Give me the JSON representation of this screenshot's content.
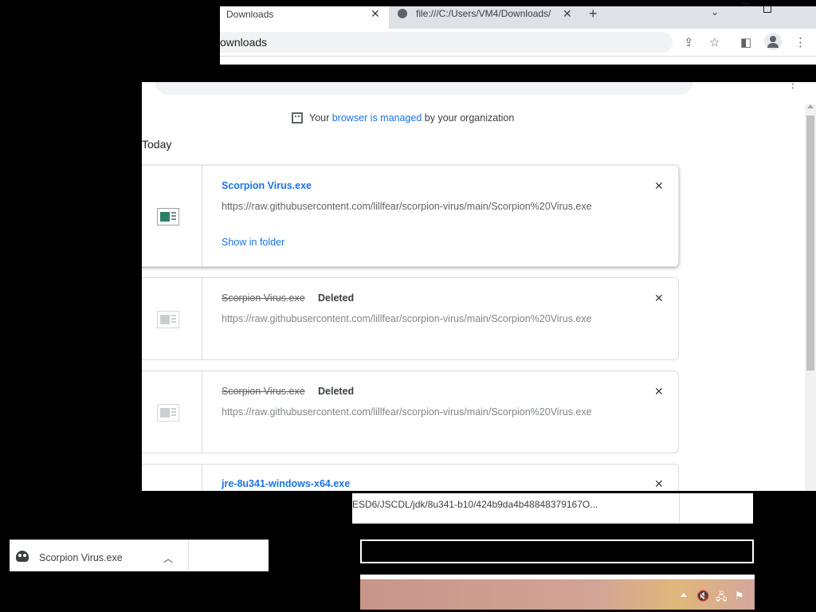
{
  "browser": {
    "tabs": [
      {
        "title": "Downloads",
        "active": true
      },
      {
        "title": "file:///C:/Users/VM4/Downloads/",
        "active": false
      }
    ],
    "omnibox_text": "ownloads",
    "icons": {
      "share": "share-icon",
      "bookmark": "star-icon",
      "sidepanel": "side-panel-icon",
      "profile": "profile-icon",
      "menu": "kebab-menu-icon"
    }
  },
  "page": {
    "managed": {
      "prefix": "Your ",
      "link": "browser is managed",
      "suffix": " by your organization"
    },
    "section_label": "Today",
    "downloads": [
      {
        "name": "Scorpion Virus.exe",
        "status": "",
        "url": "https://raw.githubusercontent.com/lillfear/scorpion-virus/main/Scorpion%20Virus.exe",
        "action": "Show in folder",
        "deleted": false
      },
      {
        "name": "Scorpion Virus.exe",
        "status": "Deleted",
        "url": "https://raw.githubusercontent.com/lillfear/scorpion-virus/main/Scorpion%20Virus.exe",
        "action": "",
        "deleted": true
      },
      {
        "name": "Scorpion Virus.exe",
        "status": "Deleted",
        "url": "https://raw.githubusercontent.com/lillfear/scorpion-virus/main/Scorpion%20Virus.exe",
        "action": "",
        "deleted": true
      },
      {
        "name": "jre-8u341-windows-x64.exe",
        "status": "",
        "url": "ESD6/JSCDL/jdk/8u341-b10/424b9da4b48848379167O...",
        "action": "",
        "deleted": false
      }
    ]
  },
  "download_bar": {
    "item_name": "Scorpion Virus.exe",
    "icon": "skull-icon"
  },
  "colors": {
    "link": "#1a73e8",
    "muted": "#5f6368"
  }
}
